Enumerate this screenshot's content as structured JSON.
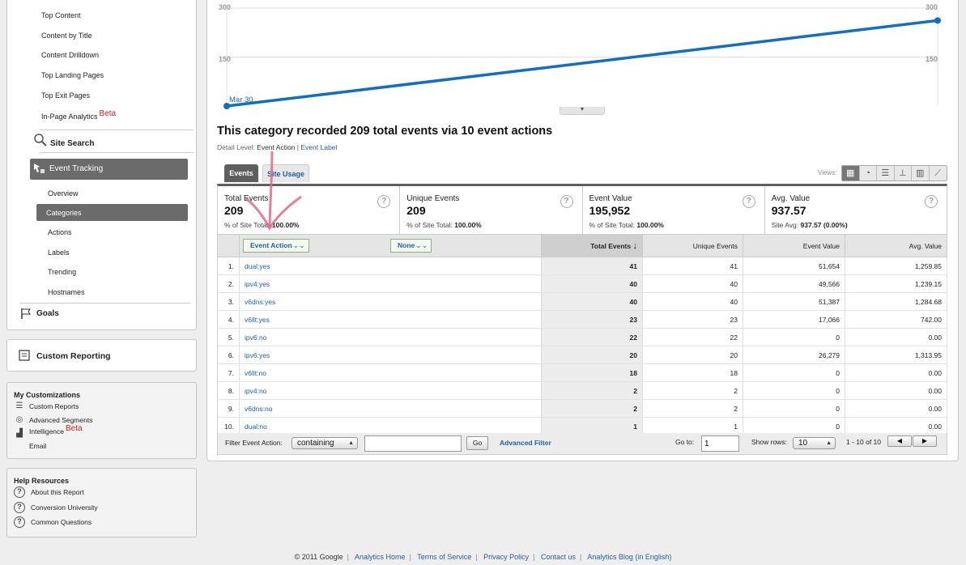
{
  "sidebar": {
    "content_items": [
      "Top Content",
      "Content by Title",
      "Content Drilldown",
      "Top Landing Pages",
      "Top Exit Pages",
      "In-Page Analytics"
    ],
    "beta_label": "Beta",
    "site_search": "Site Search",
    "event_tracking": "Event Tracking",
    "event_items": [
      "Overview",
      "Categories",
      "Actions",
      "Labels",
      "Trending",
      "Hostnames"
    ],
    "goals": "Goals",
    "custom_reporting": "Custom Reporting",
    "my_customizations": {
      "title": "My Customizations",
      "items": [
        "Custom Reports",
        "Advanced Segments",
        "Intelligence",
        "Email"
      ],
      "intelligence_beta": "Beta"
    },
    "help": {
      "title": "Help Resources",
      "items": [
        "About this Report",
        "Conversion University",
        "Common Questions"
      ]
    }
  },
  "chart": {
    "y_top_label": "300",
    "y_mid_label": "150",
    "date_label": "Mar 30",
    "collapse_icon": "▼",
    "line_color": "#0f6ec8"
  },
  "chart_data": {
    "type": "line",
    "x": [
      "Mar 30",
      ""
    ],
    "series": [
      {
        "values": [
          0,
          262
        ]
      }
    ],
    "ylim": [
      0,
      300
    ],
    "y_ticks": [
      "150",
      "300"
    ],
    "grid": true
  },
  "report": {
    "headline": "This category recorded 209 total events via 10 event actions",
    "detail_level_label": "Detail Level:",
    "detail_current": "Event Action",
    "detail_sep": "|",
    "detail_link": "Event Label"
  },
  "tabs": {
    "events": "Events",
    "site_usage": "Site Usage"
  },
  "views": {
    "label": "Views:",
    "icons": [
      "▦",
      "◔",
      "☰",
      "⊥",
      "▥",
      "⟋"
    ]
  },
  "metrics": [
    {
      "label": "Total Events",
      "value": "209",
      "sub_prefix": "% of Site Total:",
      "sub_value": "100.00%"
    },
    {
      "label": "Unique Events",
      "value": "209",
      "sub_prefix": "% of Site Total:",
      "sub_value": "100.00%"
    },
    {
      "label": "Event Value",
      "value": "195,952",
      "sub_prefix": "% of Site Total:",
      "sub_value": "100.00%"
    },
    {
      "label": "Avg. Value",
      "value": "937.57",
      "sub_prefix": "Site Avg:",
      "sub_value": "937.57 (0.00%)"
    }
  ],
  "table": {
    "dim1": "Event Action",
    "dim2": "None",
    "headers": [
      "Total Events",
      "Unique Events",
      "Event Value",
      "Avg. Value"
    ],
    "sort_icon": "↓",
    "rows": [
      [
        "1.",
        "dual:yes",
        "41",
        "41",
        "51,654",
        "1,259.85"
      ],
      [
        "2.",
        "ipv4:yes",
        "40",
        "40",
        "49,566",
        "1,239.15"
      ],
      [
        "3.",
        "v6dns:yes",
        "40",
        "40",
        "51,387",
        "1,284.68"
      ],
      [
        "4.",
        "v6llt:yes",
        "23",
        "23",
        "17,066",
        "742.00"
      ],
      [
        "5.",
        "ipv6:no",
        "22",
        "22",
        "0",
        "0.00"
      ],
      [
        "6.",
        "ipv6:yes",
        "20",
        "20",
        "26,279",
        "1,313.95"
      ],
      [
        "7.",
        "v6llt:no",
        "18",
        "18",
        "0",
        "0.00"
      ],
      [
        "8.",
        "ipv4:no",
        "2",
        "2",
        "0",
        "0.00"
      ],
      [
        "9.",
        "v6dns:no",
        "2",
        "2",
        "0",
        "0.00"
      ],
      [
        "10.",
        "dual:no",
        "1",
        "1",
        "0",
        "0.00"
      ]
    ]
  },
  "filter": {
    "label": "Filter Event Action:",
    "mode": "containing",
    "query": "",
    "go": "Go",
    "advanced": "Advanced Filter",
    "goto_label": "Go to:",
    "goto_value": "1",
    "show_rows_label": "Show rows:",
    "show_rows_value": "10",
    "range": "1 - 10 of 10",
    "prev": "◀",
    "next": "▶"
  },
  "footer": {
    "copyright": "© 2011 Google",
    "links": [
      "Analytics Home",
      "Terms of Service",
      "Privacy Policy",
      "Contact us",
      "Analytics Blog (in English)"
    ]
  }
}
